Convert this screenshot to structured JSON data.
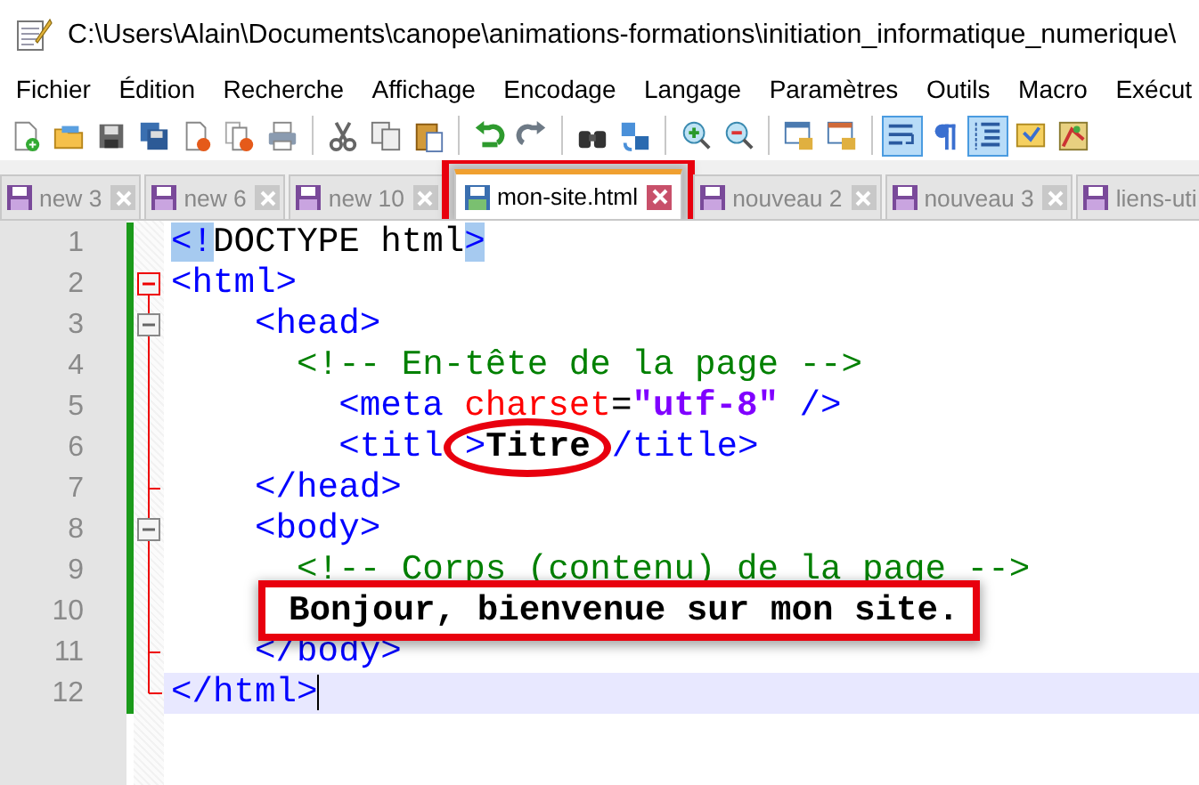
{
  "window": {
    "title": "C:\\Users\\Alain\\Documents\\canope\\animations-formations\\initiation_informatique_numerique\\"
  },
  "menu": [
    "Fichier",
    "Édition",
    "Recherche",
    "Affichage",
    "Encodage",
    "Langage",
    "Paramètres",
    "Outils",
    "Macro",
    "Exécut"
  ],
  "toolbar": [
    {
      "kind": "new",
      "on": false
    },
    {
      "kind": "open",
      "on": false
    },
    {
      "kind": "save",
      "on": false
    },
    {
      "kind": "saveall",
      "on": false
    },
    {
      "kind": "close",
      "on": false
    },
    {
      "kind": "closeall",
      "on": false
    },
    {
      "kind": "print",
      "on": false
    },
    {
      "kind": "separator"
    },
    {
      "kind": "cut",
      "on": false
    },
    {
      "kind": "copy",
      "on": false
    },
    {
      "kind": "paste",
      "on": false
    },
    {
      "kind": "separator"
    },
    {
      "kind": "undo",
      "on": false
    },
    {
      "kind": "redo",
      "on": false
    },
    {
      "kind": "separator"
    },
    {
      "kind": "find",
      "on": false
    },
    {
      "kind": "replace",
      "on": false
    },
    {
      "kind": "separator"
    },
    {
      "kind": "zoomin",
      "on": false
    },
    {
      "kind": "zoomout",
      "on": false
    },
    {
      "kind": "separator"
    },
    {
      "kind": "syncv",
      "on": false
    },
    {
      "kind": "synch",
      "on": false
    },
    {
      "kind": "separator"
    },
    {
      "kind": "wrap",
      "on": true
    },
    {
      "kind": "pilcrow",
      "on": false
    },
    {
      "kind": "indent",
      "on": true
    },
    {
      "kind": "lang",
      "on": false
    },
    {
      "kind": "map",
      "on": false
    }
  ],
  "tabs": [
    {
      "label": "new 3",
      "selected": false,
      "annotated": false
    },
    {
      "label": "new 6",
      "selected": false,
      "annotated": false
    },
    {
      "label": "new 10",
      "selected": false,
      "annotated": false
    },
    {
      "label": "mon-site.html",
      "selected": true,
      "annotated": true
    },
    {
      "label": "nouveau 2",
      "selected": false,
      "annotated": false
    },
    {
      "label": "nouveau 3",
      "selected": false,
      "annotated": false
    },
    {
      "label": "liens-uti",
      "selected": false,
      "annotated": false
    }
  ],
  "editor": {
    "lines": [
      {
        "number": "1",
        "foldable": false,
        "block_end": false,
        "current": false,
        "tokens": [
          {
            "kind": "tag",
            "text": "<!",
            "match": true
          },
          {
            "kind": "plain",
            "text": "DOCTYPE html"
          },
          {
            "kind": "tag",
            "text": ">",
            "match": true
          }
        ]
      },
      {
        "number": "2",
        "foldable": true,
        "block_end": false,
        "current": false,
        "tokens": [
          {
            "kind": "tag",
            "text": "<html>"
          }
        ]
      },
      {
        "number": "3",
        "foldable": true,
        "block_end": false,
        "current": false,
        "tokens": [
          {
            "kind": "tag",
            "text": "    <head>"
          }
        ]
      },
      {
        "number": "4",
        "foldable": false,
        "block_end": false,
        "current": false,
        "tokens": [
          {
            "kind": "comment",
            "text": "      <!-- En-tête de la page -->"
          }
        ]
      },
      {
        "number": "5",
        "foldable": false,
        "block_end": false,
        "current": false,
        "tokens": [
          {
            "kind": "tag",
            "text": "        <meta "
          },
          {
            "kind": "attr",
            "text": "charset"
          },
          {
            "kind": "plain",
            "text": "="
          },
          {
            "kind": "string",
            "text": "\"utf-8\""
          },
          {
            "kind": "tag",
            "text": " />"
          }
        ]
      },
      {
        "number": "6",
        "foldable": false,
        "block_end": false,
        "current": false,
        "tokens": [
          {
            "kind": "tag",
            "text": "        <titl",
            "circled": false
          },
          {
            "kind": "tag",
            "text": ">",
            "circled": true
          },
          {
            "kind": "text",
            "text": "Titre",
            "circled": true
          },
          {
            "kind": "tag",
            "text": "/title>",
            "circled": false
          }
        ]
      },
      {
        "number": "7",
        "foldable": false,
        "block_end": true,
        "current": false,
        "tokens": [
          {
            "kind": "tag",
            "text": "    </head>"
          }
        ]
      },
      {
        "number": "8",
        "foldable": true,
        "block_end": false,
        "current": false,
        "tokens": [
          {
            "kind": "tag",
            "text": "    <body>"
          }
        ]
      },
      {
        "number": "9",
        "foldable": false,
        "block_end": false,
        "current": false,
        "tokens": [
          {
            "kind": "comment",
            "text": "      <!-- Corps (contenu) de la page -->"
          }
        ]
      },
      {
        "number": "10",
        "foldable": false,
        "block_end": false,
        "current": false,
        "tokens": [
          {
            "kind": "text",
            "text": "Bonjour, bienvenue sur mon site.",
            "boxed": true
          }
        ]
      },
      {
        "number": "11",
        "foldable": false,
        "block_end": true,
        "current": false,
        "tokens": [
          {
            "kind": "tag",
            "text": "    </body>"
          }
        ]
      },
      {
        "number": "12",
        "foldable": false,
        "block_end": true,
        "current": true,
        "tokens": [
          {
            "kind": "tag",
            "text": "</html>"
          }
        ]
      }
    ]
  }
}
